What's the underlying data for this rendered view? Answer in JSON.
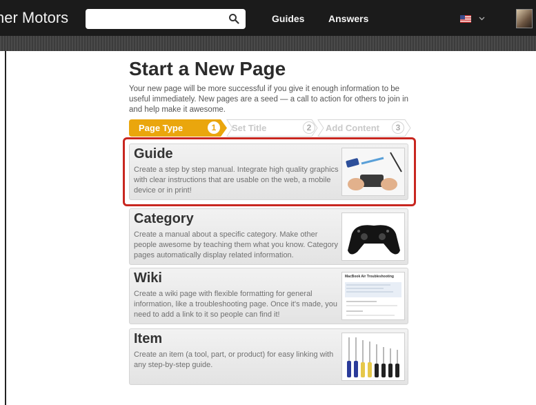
{
  "header": {
    "brand": "ner Motors",
    "search": {
      "value": "",
      "placeholder": ""
    },
    "nav": [
      "Guides",
      "Answers"
    ],
    "flag_icon": "us-flag-icon",
    "menu_icon": "chevron-down-icon"
  },
  "page": {
    "title": "Start a New Page",
    "intro": "Your new page will be more successful if you give it enough information to be useful immediately. New pages are a seed — a call to action for others to join in and help make it awesome."
  },
  "steps": [
    {
      "label": "Page Type",
      "number": "1",
      "active": true
    },
    {
      "label": "Set Title",
      "number": "2",
      "active": false
    },
    {
      "label": "Add Content",
      "number": "3",
      "active": false
    }
  ],
  "options": [
    {
      "title": "Guide",
      "description": "Create a step by step manual. Integrate high quality graphics with clear instructions that are usable on the web, a mobile device or in print!",
      "selected": true
    },
    {
      "title": "Category",
      "description": "Create a manual about a specific category. Make other people awesome by teaching them what you know. Category pages automatically display related information.",
      "selected": false
    },
    {
      "title": "Wiki",
      "description": "Create a wiki page with flexible formatting for general information, like a troubleshooting page. Once it's made, you need to add a link to it so people can find it!",
      "selected": false
    },
    {
      "title": "Item",
      "description": "Create an item (a tool, part, or product) for easy linking with any step-by-step guide.",
      "selected": false
    }
  ],
  "wiki_thumb_title": "MacBook Air Troubleshooting",
  "colors": {
    "accent": "#e9a40c",
    "highlight": "#c8261f",
    "topbar": "#1b1b1b"
  }
}
